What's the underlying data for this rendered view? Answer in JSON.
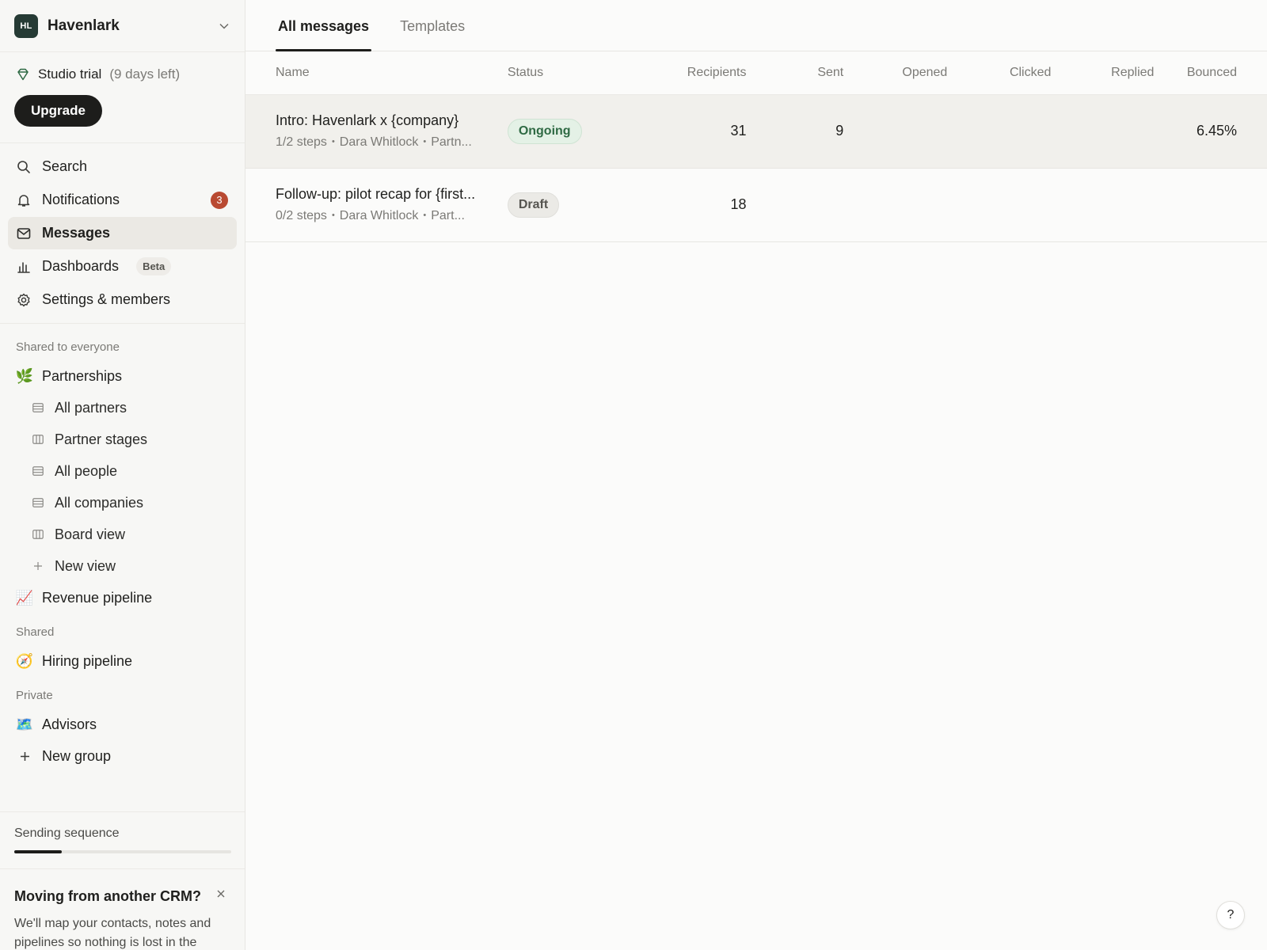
{
  "workspace": {
    "initials": "HL",
    "name": "Havenlark"
  },
  "trial": {
    "plan": "Studio trial",
    "days_left": "(9 days left)",
    "upgrade_label": "Upgrade"
  },
  "nav": {
    "search": "Search",
    "notifications": "Notifications",
    "notifications_count": "3",
    "messages": "Messages",
    "dashboards": "Dashboards",
    "dashboards_badge": "Beta",
    "settings": "Settings & members"
  },
  "sections": {
    "shared_everyone": {
      "title": "Shared to everyone",
      "group": {
        "emoji": "🌿",
        "label": "Partnerships"
      },
      "views": [
        {
          "label": "All partners",
          "icon": "table-icon"
        },
        {
          "label": "Partner stages",
          "icon": "board-icon"
        },
        {
          "label": "All people",
          "icon": "table-icon"
        },
        {
          "label": "All companies",
          "icon": "table-icon"
        },
        {
          "label": "Board view",
          "icon": "board-icon"
        }
      ],
      "new_view": "New view",
      "group2": {
        "emoji": "📈",
        "label": "Revenue pipeline"
      }
    },
    "shared": {
      "title": "Shared",
      "group": {
        "emoji": "🧭",
        "label": "Hiring pipeline"
      }
    },
    "private": {
      "title": "Private",
      "group": {
        "emoji": "🗺️",
        "label": "Advisors"
      },
      "new_group": "New group"
    }
  },
  "sequence": {
    "label": "Sending sequence",
    "progress": 0.22
  },
  "promo": {
    "title": "Moving from another CRM?",
    "body": "We'll map your contacts, notes and pipelines so nothing is lost in the"
  },
  "tabs": [
    {
      "label": "All messages"
    },
    {
      "label": "Templates"
    }
  ],
  "table": {
    "columns": [
      "Name",
      "Status",
      "Recipients",
      "Sent",
      "Opened",
      "Clicked",
      "Replied",
      "Bounced"
    ],
    "rows": [
      {
        "title": "Intro: Havenlark x {company}",
        "steps": "1/2 steps",
        "owner": "Dara Whitlock",
        "group": "Partn...",
        "status": "Ongoing",
        "recipients": "31",
        "sent": "9",
        "opened": "",
        "clicked": "",
        "replied": "",
        "bounced": "6.45%"
      },
      {
        "title": "Follow-up: pilot recap for {first...",
        "steps": "0/2 steps",
        "owner": "Dara Whitlock",
        "group": "Part...",
        "status": "Draft",
        "recipients": "18",
        "sent": "",
        "opened": "",
        "clicked": "",
        "replied": "",
        "bounced": ""
      }
    ]
  },
  "help": "?"
}
